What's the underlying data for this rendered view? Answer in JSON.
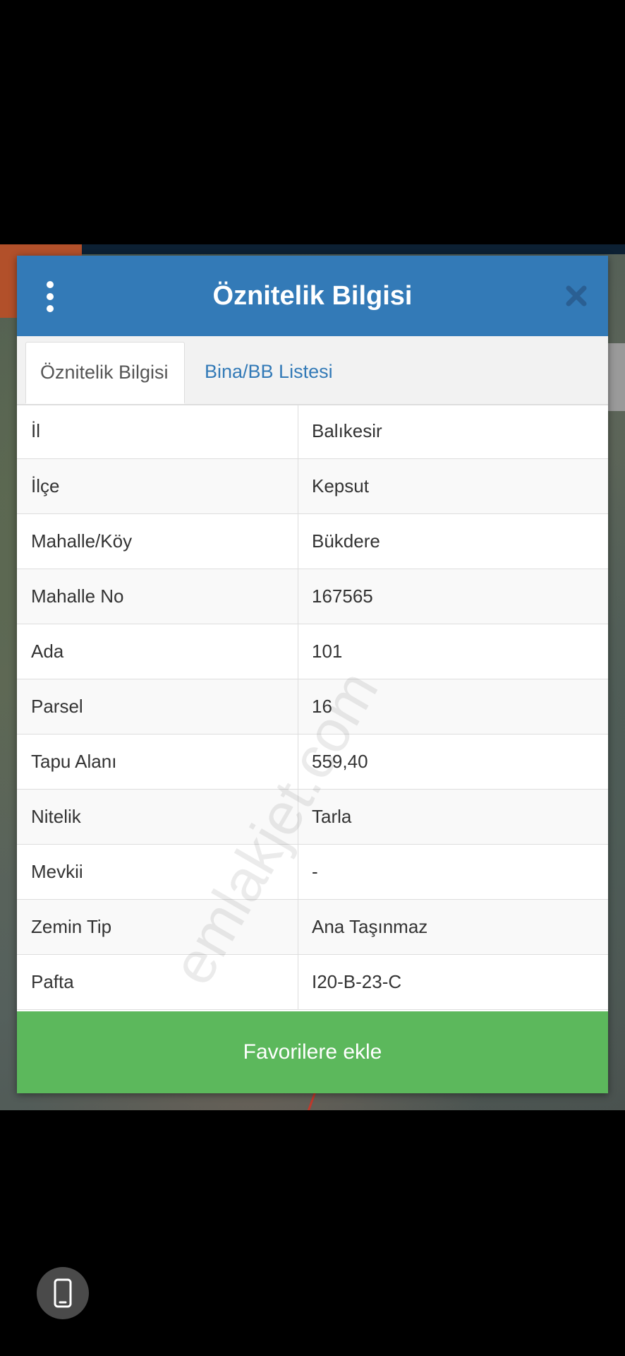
{
  "dialog": {
    "title": "Öznitelik Bilgisi",
    "menu_icon": "more-vertical-icon",
    "close_icon": "close-icon"
  },
  "tabs": [
    {
      "label": "Öznitelik Bilgisi",
      "active": true
    },
    {
      "label": "Bina/BB Listesi",
      "active": false
    }
  ],
  "attributes": [
    {
      "key": "İl",
      "value": "Balıkesir"
    },
    {
      "key": "İlçe",
      "value": "Kepsut"
    },
    {
      "key": "Mahalle/Köy",
      "value": "Bükdere"
    },
    {
      "key": "Mahalle No",
      "value": "167565"
    },
    {
      "key": "Ada",
      "value": "101"
    },
    {
      "key": "Parsel",
      "value": "16"
    },
    {
      "key": "Tapu Alanı",
      "value": "559,40"
    },
    {
      "key": "Nitelik",
      "value": "Tarla"
    },
    {
      "key": "Mevkii",
      "value": "-"
    },
    {
      "key": "Zemin Tip",
      "value": "Ana Taşınmaz"
    },
    {
      "key": "Pafta",
      "value": "I20-B-23-C"
    }
  ],
  "actions": {
    "favorite_label": "Favorilere ekle"
  },
  "watermark": "emlakjet.com",
  "floating_button_icon": "phone-icon",
  "colors": {
    "header": "#337ab7",
    "favorite_button": "#5cb85c",
    "tab_link": "#337ab7"
  }
}
